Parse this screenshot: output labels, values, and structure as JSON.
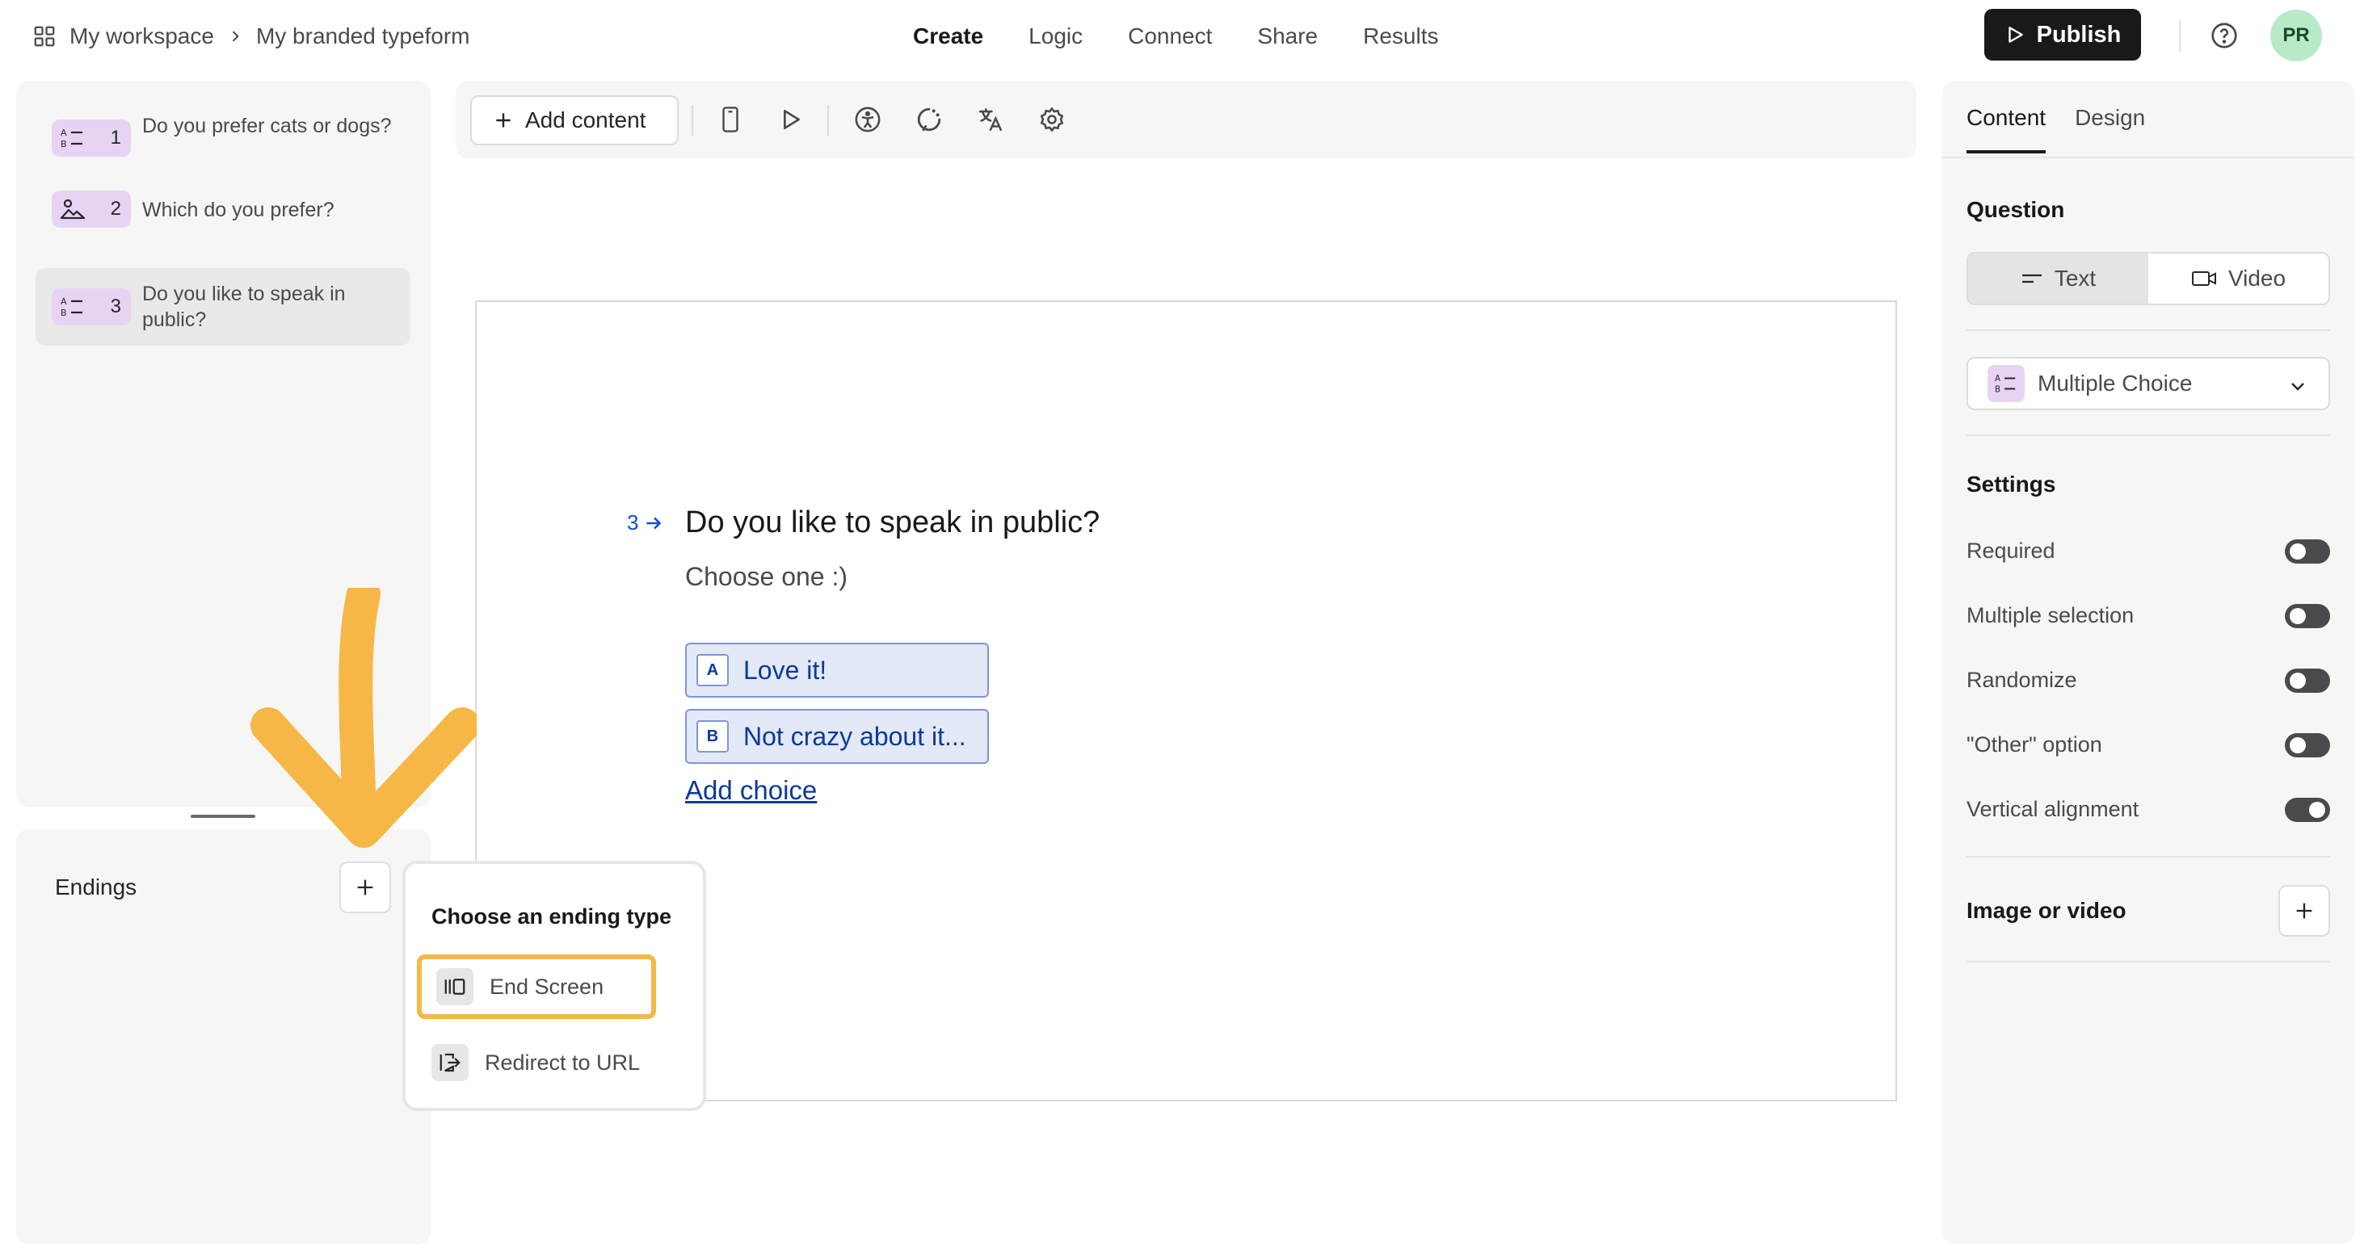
{
  "breadcrumb": {
    "workspace": "My workspace",
    "form": "My branded typeform"
  },
  "nav": {
    "items": [
      "Create",
      "Logic",
      "Connect",
      "Share",
      "Results"
    ],
    "active": "Create"
  },
  "header": {
    "publish_label": "Publish",
    "avatar_initials": "PR"
  },
  "questions": [
    {
      "number": "1",
      "text": "Do you prefer cats or dogs?",
      "icon": "multiple-choice-icon"
    },
    {
      "number": "2",
      "text": "Which do you prefer?",
      "icon": "picture-choice-icon"
    },
    {
      "number": "3",
      "text": "Do you like to speak in public?",
      "icon": "multiple-choice-icon",
      "selected": true
    }
  ],
  "endings": {
    "title": "Endings"
  },
  "toolbar": {
    "add_content_label": "Add content",
    "icons": [
      "mobile-preview-icon",
      "play-icon",
      "accessibility-icon",
      "loading-icon",
      "translate-icon",
      "settings-icon"
    ]
  },
  "canvas": {
    "question_number": "3",
    "question_title": "Do you like to speak in public?",
    "question_subtitle": "Choose one :)",
    "choices": [
      {
        "key": "A",
        "label": "Love it!"
      },
      {
        "key": "B",
        "label": "Not crazy about it..."
      }
    ],
    "add_choice_label": "Add choice"
  },
  "popover": {
    "title": "Choose an ending type",
    "options": [
      {
        "label": "End Screen",
        "icon": "end-screen-icon",
        "highlighted": true
      },
      {
        "label": "Redirect to URL",
        "icon": "redirect-icon"
      }
    ]
  },
  "right_panel": {
    "tabs": [
      "Content",
      "Design"
    ],
    "active_tab": "Content",
    "question_section": "Question",
    "segment": [
      "Text",
      "Video"
    ],
    "segment_active": "Text",
    "question_type": "Multiple Choice",
    "settings_title": "Settings",
    "settings": [
      {
        "label": "Required",
        "on": false
      },
      {
        "label": "Multiple selection",
        "on": false
      },
      {
        "label": "Randomize",
        "on": false
      },
      {
        "label": "\"Other\" option",
        "on": false
      },
      {
        "label": "Vertical alignment",
        "on": true
      }
    ],
    "media_title": "Image or video"
  },
  "colors": {
    "accent_blue": "#0b3a9a",
    "highlight_orange": "#f7b747",
    "badge_purple": "#e7d4f4"
  }
}
